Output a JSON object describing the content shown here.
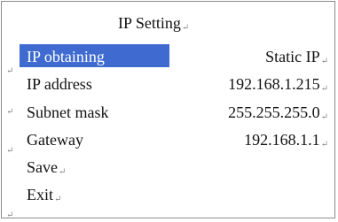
{
  "dialog": {
    "title": "IP Setting",
    "paragraph_mark": "↵"
  },
  "menu": {
    "items": [
      {
        "label": "IP obtaining",
        "value": "Static IP"
      },
      {
        "label": "IP address",
        "value": "192.168.1.215"
      },
      {
        "label": "Subnet mask",
        "value": "255.255.255.0"
      },
      {
        "label": "Gateway",
        "value": "192.168.1.1"
      },
      {
        "label": "Save"
      },
      {
        "label": "Exit"
      }
    ]
  },
  "colors": {
    "selection": "#3f6bd0",
    "border": "#8a8a8a",
    "text": "#111111"
  }
}
